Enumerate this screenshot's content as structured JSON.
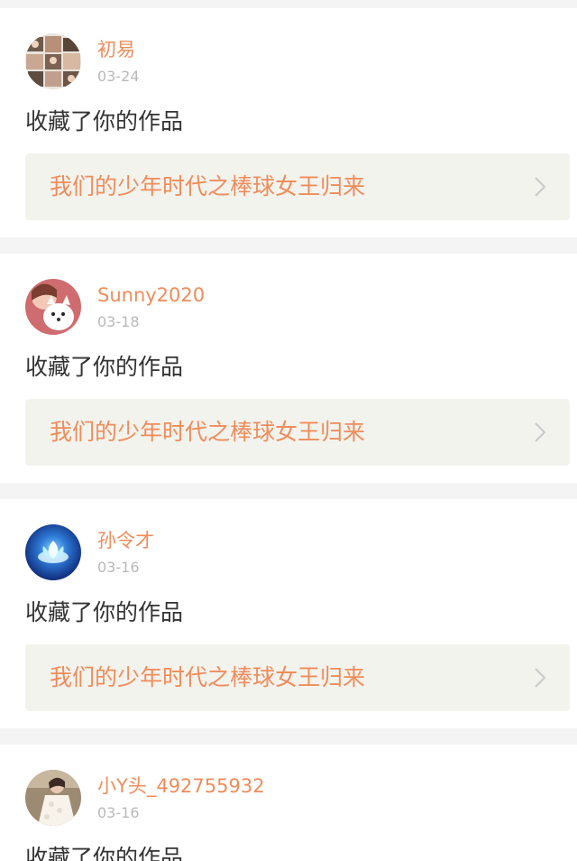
{
  "notifications": [
    {
      "username": "初易",
      "date": "03-24",
      "action": "收藏了你的作品",
      "work_title": "我们的少年时代之棒球女王归来",
      "avatar_icon": "group-photo-avatar"
    },
    {
      "username": "Sunny2020",
      "date": "03-18",
      "action": "收藏了你的作品",
      "work_title": "我们的少年时代之棒球女王归来",
      "avatar_icon": "girl-with-dog-avatar"
    },
    {
      "username": "孙令才",
      "date": "03-16",
      "action": "收藏了你的作品",
      "work_title": "我们的少年时代之棒球女王归来",
      "avatar_icon": "blue-lotus-avatar"
    },
    {
      "username": "小Y头_492755932",
      "date": "03-16",
      "action": "收藏了你的作品",
      "avatar_icon": "lace-dress-avatar"
    }
  ],
  "colors": {
    "accent": "#f08c5a",
    "date": "#b9b9b9",
    "text": "#333333",
    "card_link_bg": "#f3f3ee",
    "page_bg": "#f4f4f4"
  },
  "icons": {
    "chevron": "chevron-right-icon"
  }
}
